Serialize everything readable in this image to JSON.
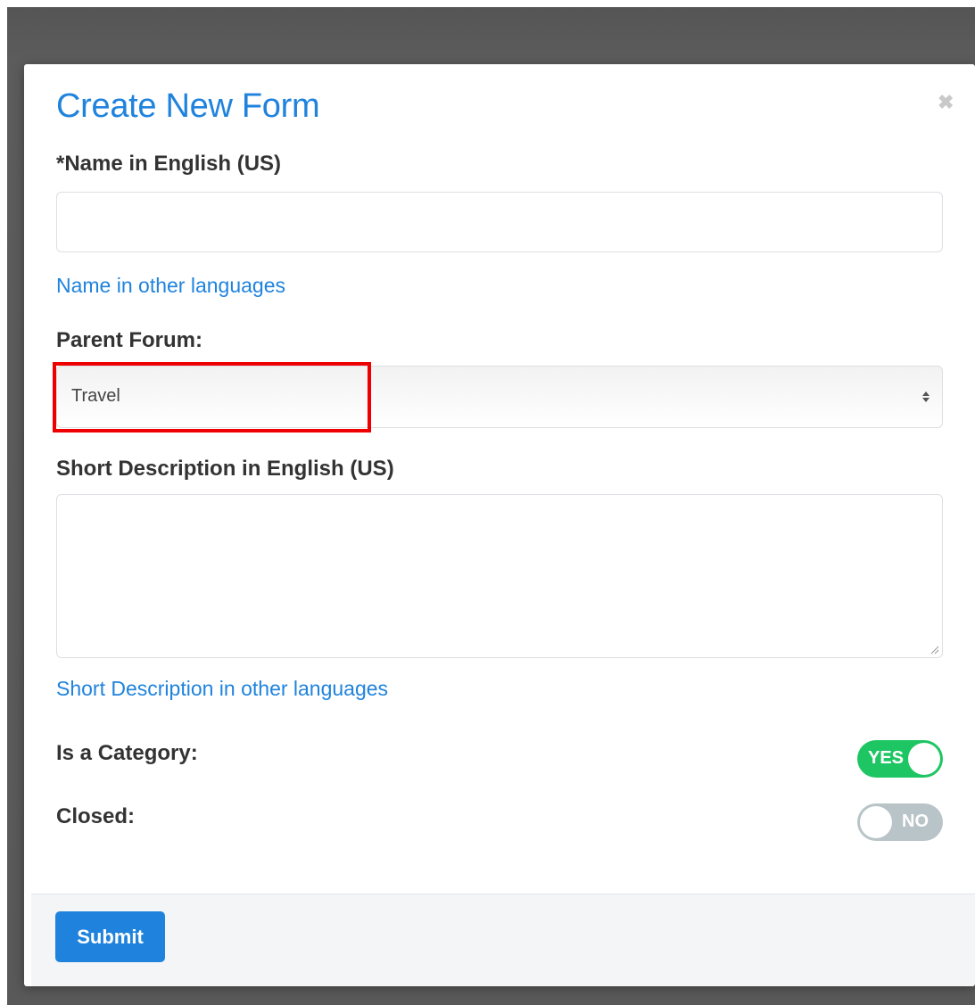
{
  "modal": {
    "title": "Create New Form",
    "close_icon": "close-icon"
  },
  "fields": {
    "name_label": "*Name in English (US)",
    "name_value": "",
    "name_other_languages": "Name in other languages",
    "parent_forum_label": "Parent Forum:",
    "parent_forum_value": "Travel",
    "short_description_label": "Short Description in English (US)",
    "short_description_value": "",
    "short_description_other_languages": "Short Description in other languages",
    "is_category_label": "Is a Category:",
    "is_category_toggle": "YES",
    "closed_label": "Closed:",
    "closed_toggle": "NO"
  },
  "footer": {
    "submit_label": "Submit"
  },
  "colors": {
    "accent": "#1f83dd",
    "toggle_on": "#1ec663",
    "toggle_off": "#b8c4c8",
    "highlight": "#ee0000"
  },
  "icons": {
    "select_arrow": "select-arrows-icon",
    "resize_grip": "resize-grip-icon"
  }
}
